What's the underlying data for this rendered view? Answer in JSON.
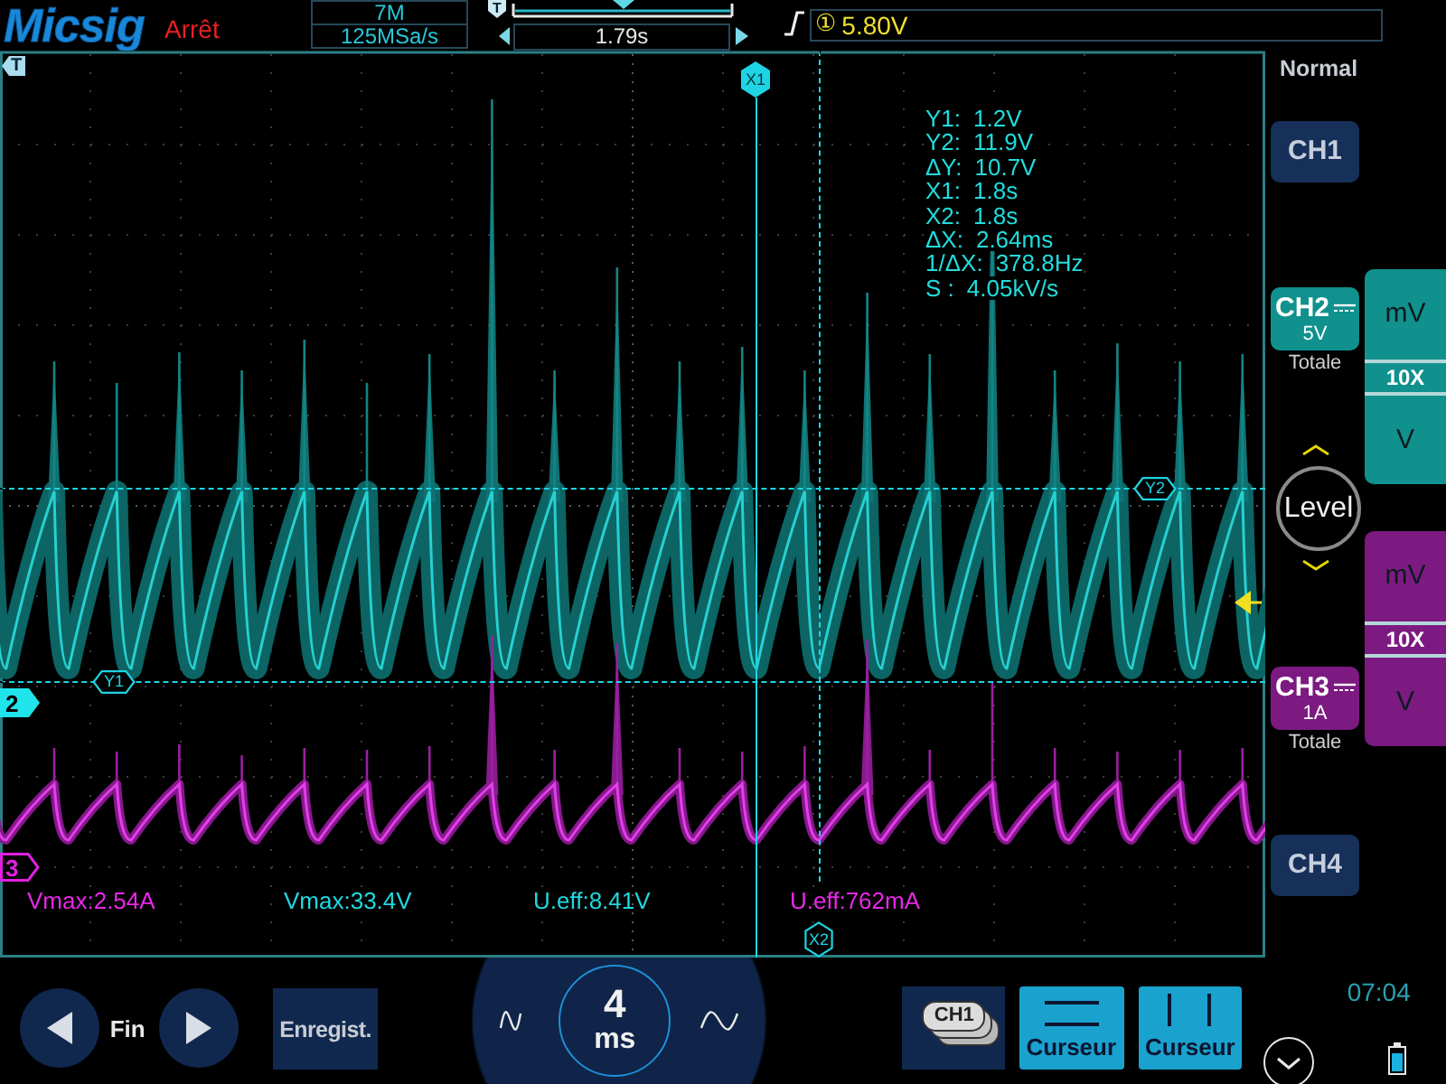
{
  "header": {
    "logo": "Micsig",
    "run_state": "Arrêt",
    "memory_depth": "7M",
    "sample_rate": "125MSa/s",
    "position_marker": "T",
    "time_position": "1.79s",
    "trigger_source": "①",
    "trigger_level": "5.80V"
  },
  "plot": {
    "trigger_marker": "T",
    "channel_markers": [
      {
        "label": "2",
        "color": "#20e4ec",
        "selected": true
      },
      {
        "label": "3",
        "color": "#e020e0",
        "selected": false
      }
    ],
    "cursors": [
      {
        "label": "X1",
        "kind": "vertical",
        "selected": true
      },
      {
        "label": "Y2",
        "kind": "horizontal",
        "selected": false
      },
      {
        "label": "Y1",
        "kind": "horizontal",
        "selected": false
      },
      {
        "label": "X2",
        "kind": "vertical",
        "selected": false
      }
    ],
    "cursor_readout": [
      {
        "label": "Y1:",
        "value": "1.2V"
      },
      {
        "label": "Y2:",
        "value": "11.9V"
      },
      {
        "label": "ΔY:",
        "value": "10.7V"
      },
      {
        "label": "X1:",
        "value": "1.8s"
      },
      {
        "label": "X2:",
        "value": "1.8s"
      },
      {
        "label": "ΔX:",
        "value": "2.64ms"
      },
      {
        "label": "1/ΔX:",
        "value": "378.8Hz"
      },
      {
        "label": "S :",
        "value": "4.05kV/s"
      }
    ],
    "measurements": [
      {
        "text": "Vmax:2.54A",
        "color": "#e828e8"
      },
      {
        "text": "Vmax:33.4V",
        "color": "#20d8e0"
      },
      {
        "text": "U.eff:8.41V",
        "color": "#20d8e0"
      },
      {
        "text": "U.eff:762mA",
        "color": "#e828e8"
      }
    ]
  },
  "side": {
    "trigger_mode": "Normal",
    "channels": [
      {
        "label": "CH1",
        "on": false
      },
      {
        "label": "CH2",
        "on": true,
        "color": "#10918d",
        "scale": "5V",
        "coupling": "Totale",
        "scale_panel": {
          "upper_unit": "mV",
          "probe": "10X",
          "lower_unit": "V"
        }
      },
      {
        "label": "CH3",
        "on": true,
        "color": "#7d1a82",
        "scale": "1A",
        "coupling": "Totale",
        "scale_panel": {
          "upper_unit": "mV",
          "probe": "10X",
          "lower_unit": "V"
        }
      },
      {
        "label": "CH4",
        "on": false
      }
    ],
    "level_knob": "Level"
  },
  "footer": {
    "nav_label": "Fin",
    "record_button": "Enregist.",
    "timebase": {
      "value": "4",
      "unit": "ms"
    },
    "channel_stack": "CH1",
    "cursor_buttons": [
      {
        "label": "Curseur",
        "kind": "horizontal",
        "on": true
      },
      {
        "label": "Curseur",
        "kind": "vertical",
        "on": true
      }
    ],
    "clock": "07:04"
  }
}
